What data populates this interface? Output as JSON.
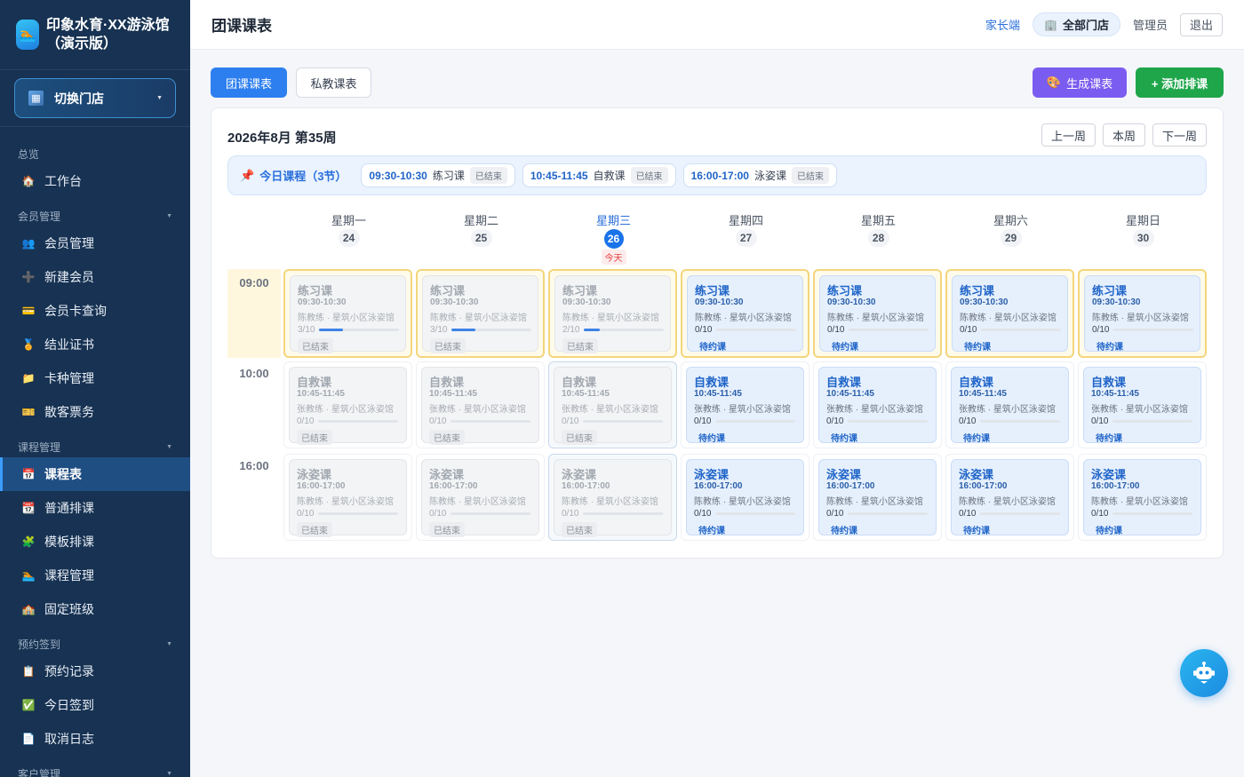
{
  "brand": {
    "title": "印象水育·XX游泳馆（演示版）"
  },
  "store_switch": {
    "label": "切换门店"
  },
  "nav": [
    {
      "type": "group",
      "label": "总览",
      "collapsible": false
    },
    {
      "type": "item",
      "label": "工作台",
      "icon": "🏠",
      "name": "workbench"
    },
    {
      "type": "group",
      "label": "会员管理",
      "collapsible": true
    },
    {
      "type": "item",
      "label": "会员管理",
      "icon": "👥",
      "name": "member-management"
    },
    {
      "type": "item",
      "label": "新建会员",
      "icon": "➕",
      "name": "new-member"
    },
    {
      "type": "item",
      "label": "会员卡查询",
      "icon": "💳",
      "name": "member-card-query"
    },
    {
      "type": "item",
      "label": "结业证书",
      "icon": "🏅",
      "name": "certificate"
    },
    {
      "type": "item",
      "label": "卡种管理",
      "icon": "📁",
      "name": "card-type-management"
    },
    {
      "type": "item",
      "label": "散客票务",
      "icon": "🎫",
      "name": "walkin-tickets"
    },
    {
      "type": "group",
      "label": "课程管理",
      "collapsible": true
    },
    {
      "type": "item",
      "label": "课程表",
      "icon": "📅",
      "name": "timetable",
      "active": true
    },
    {
      "type": "item",
      "label": "普通排课",
      "icon": "📆",
      "name": "normal-scheduling"
    },
    {
      "type": "item",
      "label": "模板排课",
      "icon": "🧩",
      "name": "template-scheduling"
    },
    {
      "type": "item",
      "label": "课程管理",
      "icon": "🏊",
      "name": "course-management"
    },
    {
      "type": "item",
      "label": "固定班级",
      "icon": "🏫",
      "name": "fixed-class"
    },
    {
      "type": "group",
      "label": "预约签到",
      "collapsible": true
    },
    {
      "type": "item",
      "label": "预约记录",
      "icon": "📋",
      "name": "booking-records"
    },
    {
      "type": "item",
      "label": "今日签到",
      "icon": "✅",
      "name": "today-checkin"
    },
    {
      "type": "item",
      "label": "取消日志",
      "icon": "📄",
      "name": "cancel-log"
    },
    {
      "type": "group",
      "label": "客户管理",
      "collapsible": true
    }
  ],
  "topbar": {
    "title": "团课课表",
    "parent_link": "家长端",
    "store": "全部门店",
    "admin": "管理员",
    "logout": "退出"
  },
  "tabs": {
    "group": "团课课表",
    "private": "私教课表"
  },
  "actions": {
    "generate": "生成课表",
    "add": "+ 添加排课"
  },
  "week": {
    "title": "2026年8月 第35周",
    "prev": "上一周",
    "current": "本周",
    "next": "下一周"
  },
  "today_courses": {
    "label": "今日课程（3节）",
    "items": [
      {
        "time": "09:30-10:30",
        "name": "练习课",
        "status": "已结束"
      },
      {
        "time": "10:45-11:45",
        "name": "自救课",
        "status": "已结束"
      },
      {
        "time": "16:00-17:00",
        "name": "泳姿课",
        "status": "已结束"
      }
    ]
  },
  "days": [
    {
      "name": "星期一",
      "num": "24"
    },
    {
      "name": "星期二",
      "num": "25"
    },
    {
      "name": "星期三",
      "num": "26",
      "today": true,
      "today_label": "今天"
    },
    {
      "name": "星期四",
      "num": "27"
    },
    {
      "name": "星期五",
      "num": "28"
    },
    {
      "name": "星期六",
      "num": "29"
    },
    {
      "name": "星期日",
      "num": "30"
    }
  ],
  "slots": [
    {
      "time": "09:00",
      "course": "练习课",
      "range": "09:30-10:30"
    },
    {
      "time": "10:00",
      "course": "自救课",
      "range": "10:45-11:45"
    },
    {
      "time": "16:00",
      "course": "泳姿课",
      "range": "16:00-17:00"
    }
  ],
  "schedule": [
    [
      {
        "coach": "陈教练 · 星筑小区泳姿馆",
        "count": "3/10",
        "fill": 0.3,
        "status": "已结束",
        "done": true
      },
      {
        "coach": "陈教练 · 星筑小区泳姿馆",
        "count": "3/10",
        "fill": 0.3,
        "status": "已结束",
        "done": true
      },
      {
        "coach": "陈教练 · 星筑小区泳姿馆",
        "count": "2/10",
        "fill": 0.2,
        "status": "已结束",
        "done": true
      },
      {
        "coach": "陈教练 · 星筑小区泳姿馆",
        "count": "0/10",
        "fill": 0,
        "status": "待约课",
        "done": false
      },
      {
        "coach": "陈教练 · 星筑小区泳姿馆",
        "count": "0/10",
        "fill": 0,
        "status": "待约课",
        "done": false
      },
      {
        "coach": "陈教练 · 星筑小区泳姿馆",
        "count": "0/10",
        "fill": 0,
        "status": "待约课",
        "done": false
      },
      {
        "coach": "陈教练 · 星筑小区泳姿馆",
        "count": "0/10",
        "fill": 0,
        "status": "待约课",
        "done": false
      }
    ],
    [
      {
        "coach": "张教练 · 星筑小区泳姿馆",
        "count": "0/10",
        "fill": 0,
        "status": "已结束",
        "done": true
      },
      {
        "coach": "张教练 · 星筑小区泳姿馆",
        "count": "0/10",
        "fill": 0,
        "status": "已结束",
        "done": true
      },
      {
        "coach": "张教练 · 星筑小区泳姿馆",
        "count": "0/10",
        "fill": 0,
        "status": "已结束",
        "done": true
      },
      {
        "coach": "张教练 · 星筑小区泳姿馆",
        "count": "0/10",
        "fill": 0,
        "status": "待约课",
        "done": false
      },
      {
        "coach": "张教练 · 星筑小区泳姿馆",
        "count": "0/10",
        "fill": 0,
        "status": "待约课",
        "done": false
      },
      {
        "coach": "张教练 · 星筑小区泳姿馆",
        "count": "0/10",
        "fill": 0,
        "status": "待约课",
        "done": false
      },
      {
        "coach": "张教练 · 星筑小区泳姿馆",
        "count": "0/10",
        "fill": 0,
        "status": "待约课",
        "done": false
      }
    ],
    [
      {
        "coach": "陈教练 · 星筑小区泳姿馆",
        "count": "0/10",
        "fill": 0,
        "status": "已结束",
        "done": true
      },
      {
        "coach": "陈教练 · 星筑小区泳姿馆",
        "count": "0/10",
        "fill": 0,
        "status": "已结束",
        "done": true
      },
      {
        "coach": "陈教练 · 星筑小区泳姿馆",
        "count": "0/10",
        "fill": 0,
        "status": "已结束",
        "done": true
      },
      {
        "coach": "陈教练 · 星筑小区泳姿馆",
        "count": "0/10",
        "fill": 0,
        "status": "待约课",
        "done": false
      },
      {
        "coach": "陈教练 · 星筑小区泳姿馆",
        "count": "0/10",
        "fill": 0,
        "status": "待约课",
        "done": false
      },
      {
        "coach": "陈教练 · 星筑小区泳姿馆",
        "count": "0/10",
        "fill": 0,
        "status": "待约课",
        "done": false
      },
      {
        "coach": "陈教练 · 星筑小区泳姿馆",
        "count": "0/10",
        "fill": 0,
        "status": "待约课",
        "done": false
      }
    ]
  ],
  "colors": {
    "primary": "#2d7ff0",
    "sidebar": "#173252",
    "generate": "#7b5cf0",
    "add": "#1fa64b",
    "today_badge": "#e53e3e"
  },
  "icons": {
    "logo": "swim-logo-icon",
    "store": "building-icon",
    "pin": "pin-icon",
    "palette": "palette-icon",
    "assistant": "robot-icon"
  }
}
